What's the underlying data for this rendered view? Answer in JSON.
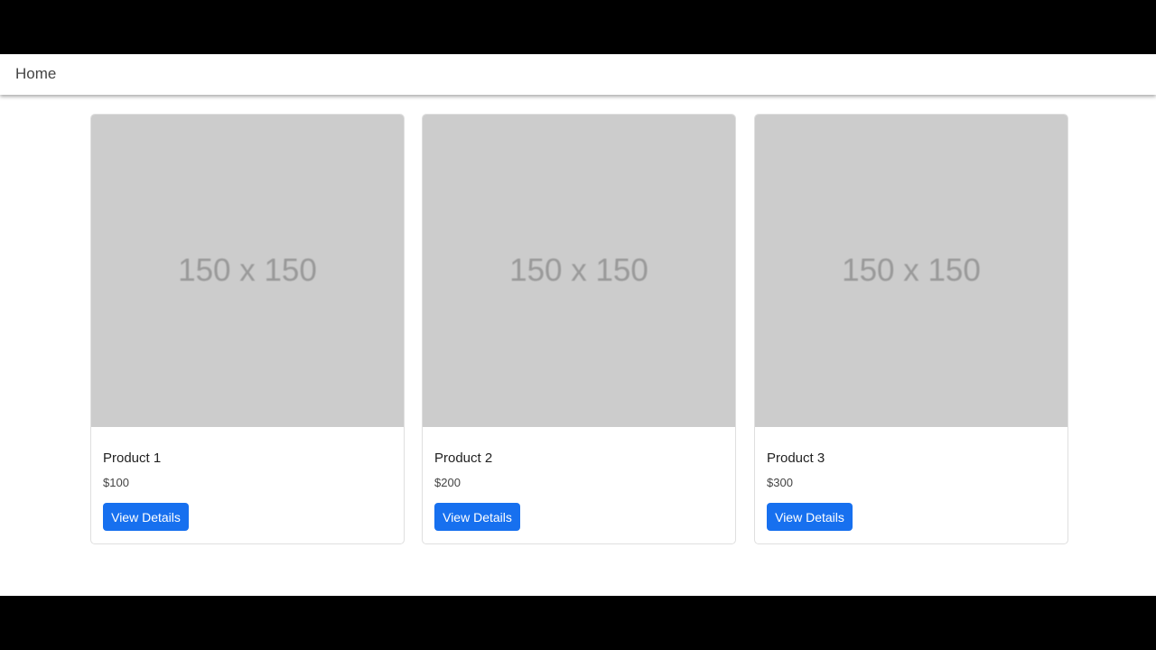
{
  "nav": {
    "home_label": "Home"
  },
  "products": [
    {
      "image_text": "150 x 150",
      "title": "Product 1",
      "price": "$100",
      "button_label": "View Details"
    },
    {
      "image_text": "150 x 150",
      "title": "Product 2",
      "price": "$200",
      "button_label": "View Details"
    },
    {
      "image_text": "150 x 150",
      "title": "Product 3",
      "price": "$300",
      "button_label": "View Details"
    }
  ],
  "colors": {
    "letterbox": "#000000",
    "page_background": "#ffffff",
    "primary_button": "#1770ef",
    "placeholder_image": "#cccccc"
  }
}
